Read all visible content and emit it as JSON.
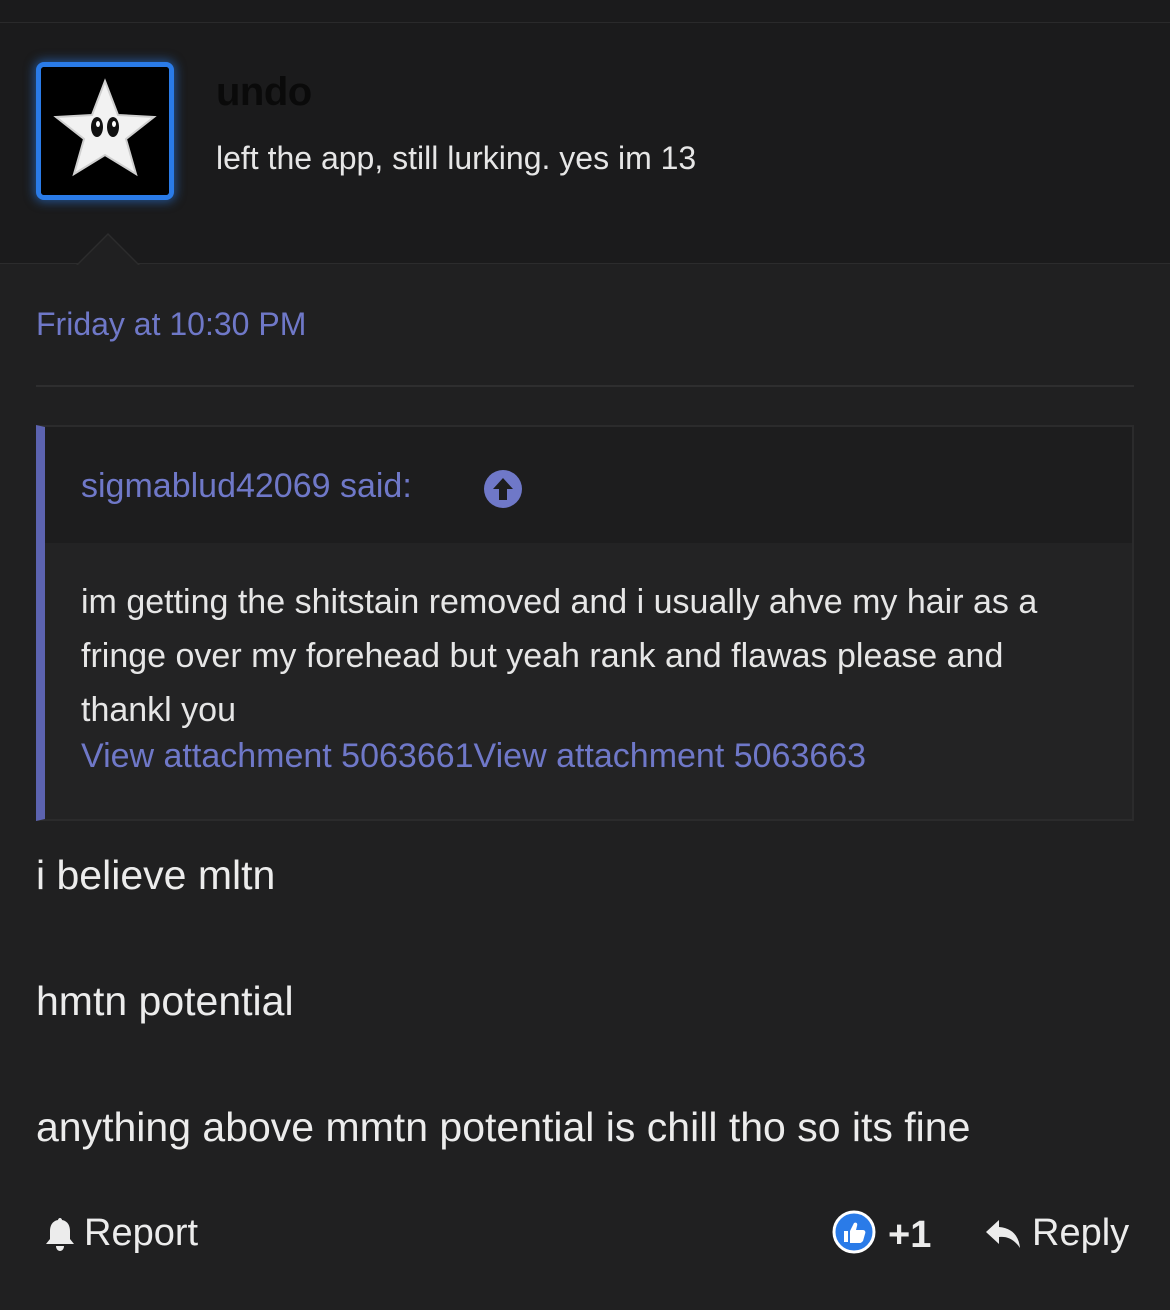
{
  "author": {
    "username": "undo",
    "title": "left the app, still lurking. yes im 13"
  },
  "post": {
    "timestamp": "Friday at 10:30 PM",
    "quote": {
      "author_line": "sigmablud42069 said:",
      "body": "im getting the shitstain removed and i usually ahve my hair as a fringe over my forehead but yeah rank and flawas please and thankl you",
      "attachments": [
        "View attachment 5063661",
        "View attachment 5063663"
      ]
    },
    "messages": [
      "i believe mltn",
      "hmtn potential",
      "anything above mmtn potential is chill tho so its fine"
    ]
  },
  "footer": {
    "report_label": "Report",
    "reaction_score": "+1",
    "reply_label": "Reply"
  },
  "colors": {
    "accent": "#6f78c8",
    "avatar_border": "#2a7be8",
    "quote_bar": "#5c63b0",
    "like_badge": "#2a7be8"
  },
  "icons": [
    "star-avatar",
    "arrow-up-icon",
    "bell-icon",
    "thumbs-up-icon",
    "reply-arrow-icon"
  ]
}
